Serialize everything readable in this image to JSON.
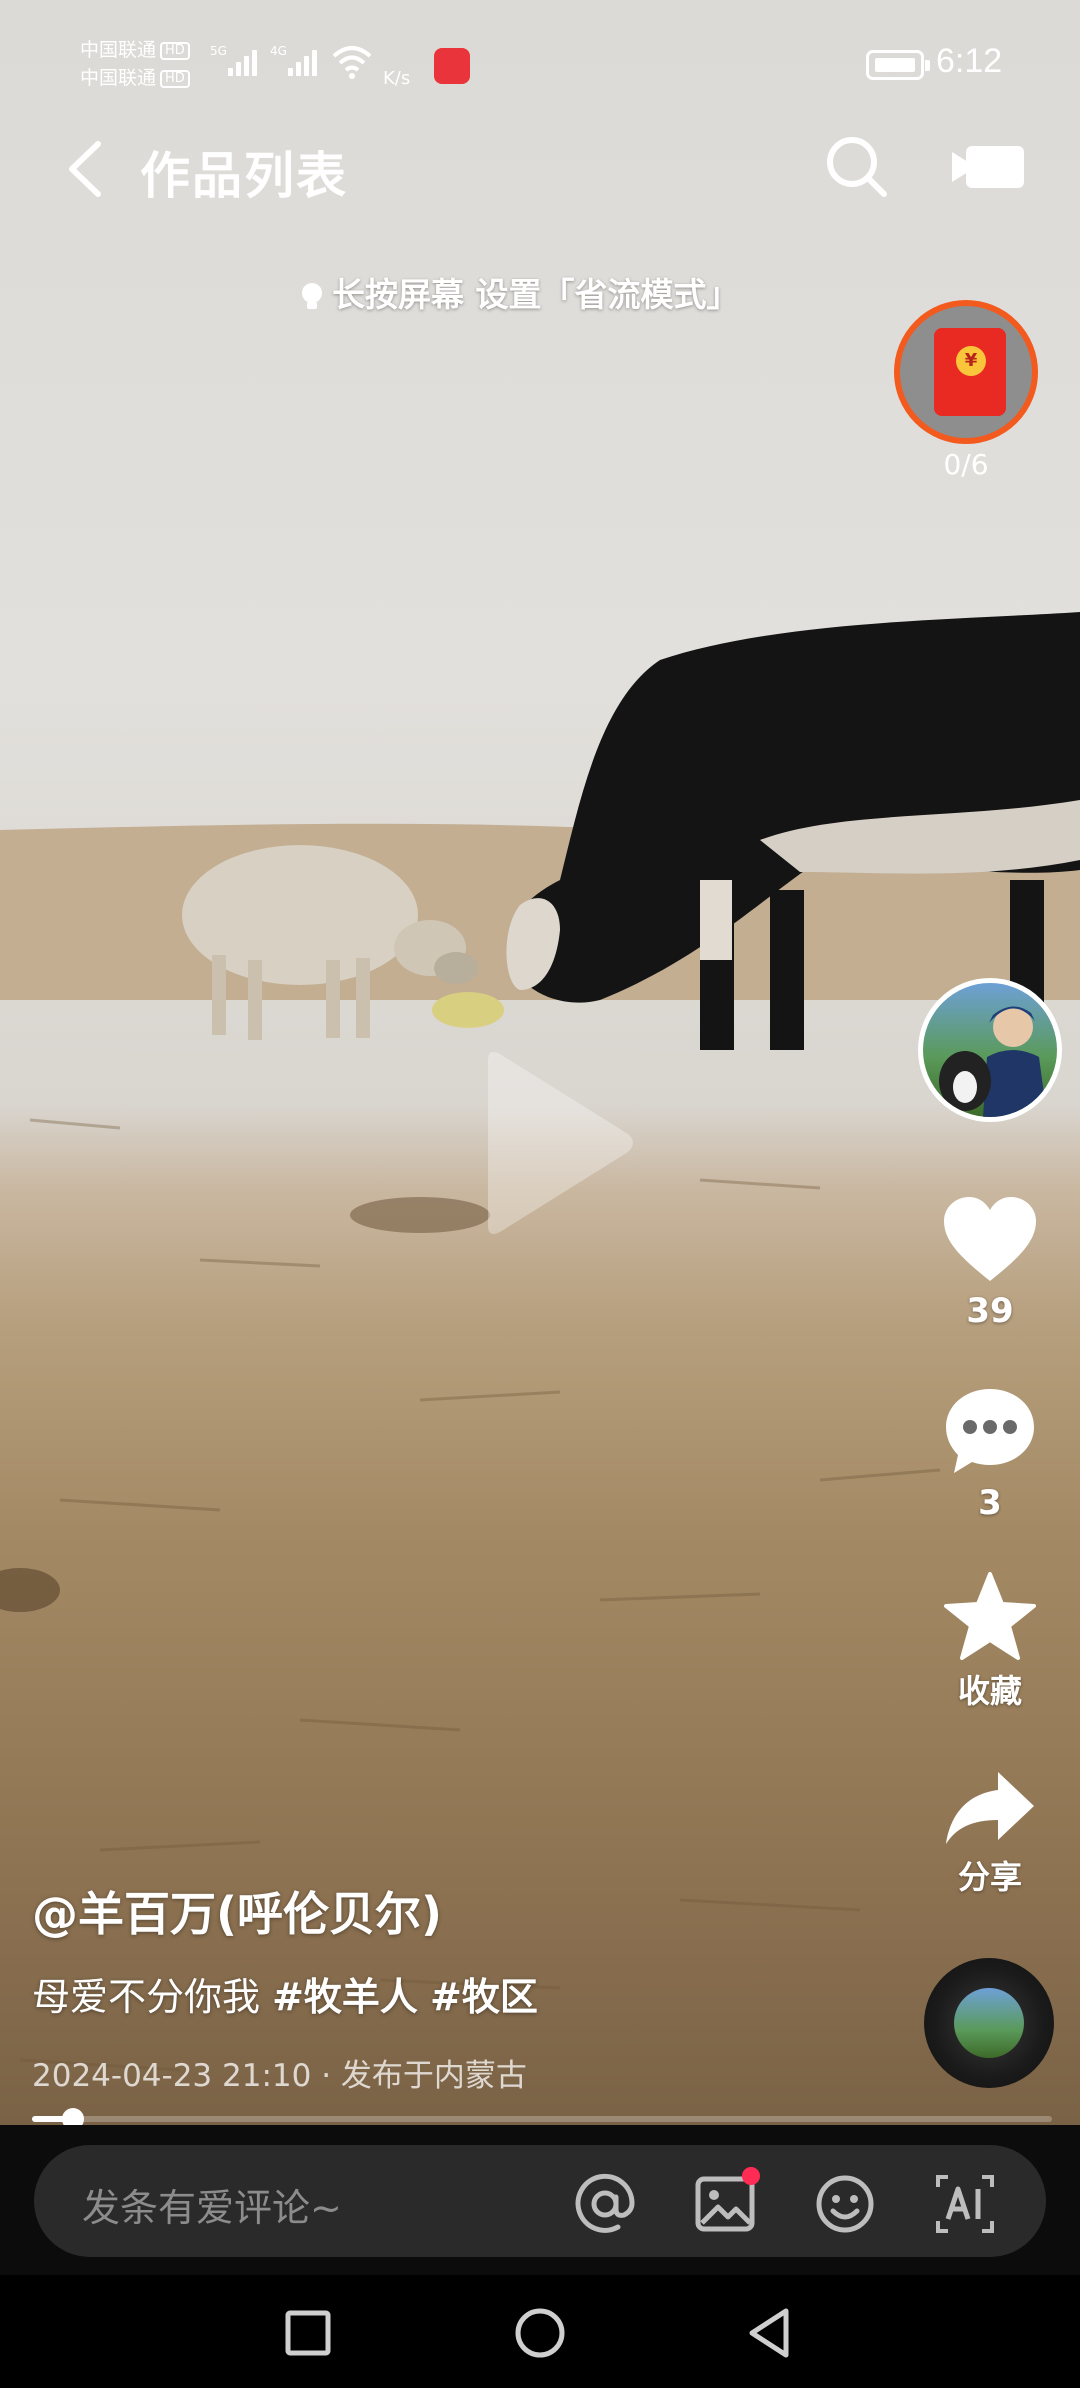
{
  "status_bar": {
    "carrier_1": "中国联通",
    "carrier_2": "中国联通",
    "hd_1": "HD",
    "hd_2": "HD",
    "net_1": "5G",
    "net_2": "4G",
    "speed": "K/s",
    "time": "6:12"
  },
  "header": {
    "title": "作品列表",
    "back_icon": "chevron-left-icon",
    "search_icon": "search-icon",
    "camera_icon": "video-camera-icon"
  },
  "hint": "长按屏幕 设置「省流模式」",
  "red_packet": {
    "count": "0/6",
    "icon": "red-envelope-icon"
  },
  "actions": {
    "likes": "39",
    "comments": "3",
    "favorite_label": "收藏",
    "share_label": "分享"
  },
  "post": {
    "author": "@羊百万(呼伦贝尔)",
    "caption_text": "母爱不分你我 ",
    "hashtags": [
      "#牧羊人",
      "#牧区"
    ],
    "date": "2024-04-23 21:10",
    "location": "· 发布于内蒙古"
  },
  "progress": {
    "played_fraction": 0.04
  },
  "comment_bar": {
    "placeholder": "发条有爱评论~",
    "at_icon": "at-icon",
    "image_icon": "image-icon",
    "emoji_icon": "emoji-icon",
    "ai_icon": "ai-text-icon"
  },
  "system_nav": {
    "recents_icon": "square-icon",
    "home_icon": "circle-icon",
    "back_icon": "triangle-back-icon"
  }
}
